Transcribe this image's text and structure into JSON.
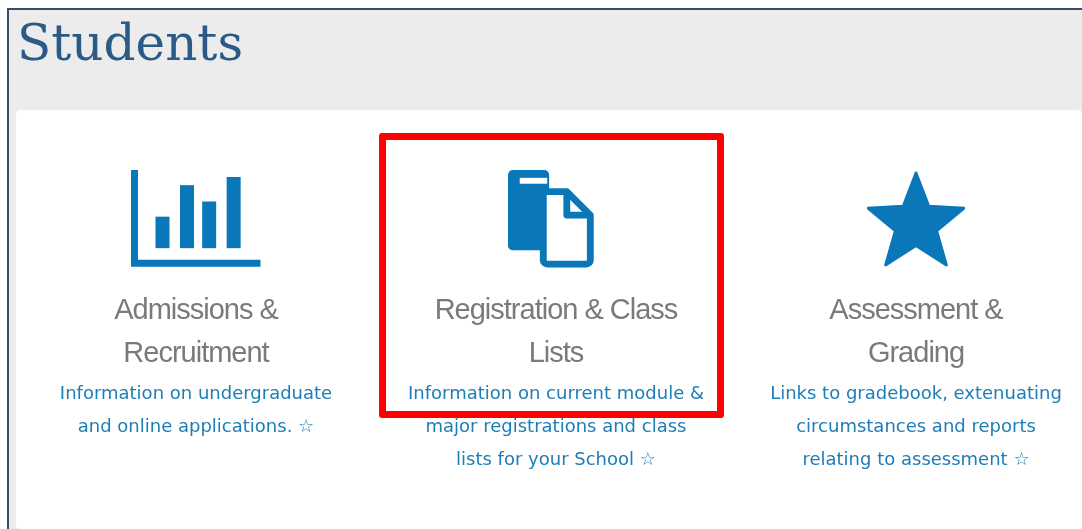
{
  "page": {
    "title": "Students"
  },
  "tiles": [
    {
      "kind": "bar-chart",
      "title": "Admissions & Recruitment",
      "description": "Information on undergraduate and online applications. ☆",
      "highlighted": false
    },
    {
      "kind": "documents",
      "title": "Registration & Class Lists",
      "description": "Information on current module & major registrations and class lists for your School ☆",
      "highlighted": true
    },
    {
      "kind": "star",
      "title": "Assessment & Grading",
      "description": "Links to gradebook, extenuating circumstances and reports relating to assessment ☆",
      "highlighted": false
    }
  ]
}
